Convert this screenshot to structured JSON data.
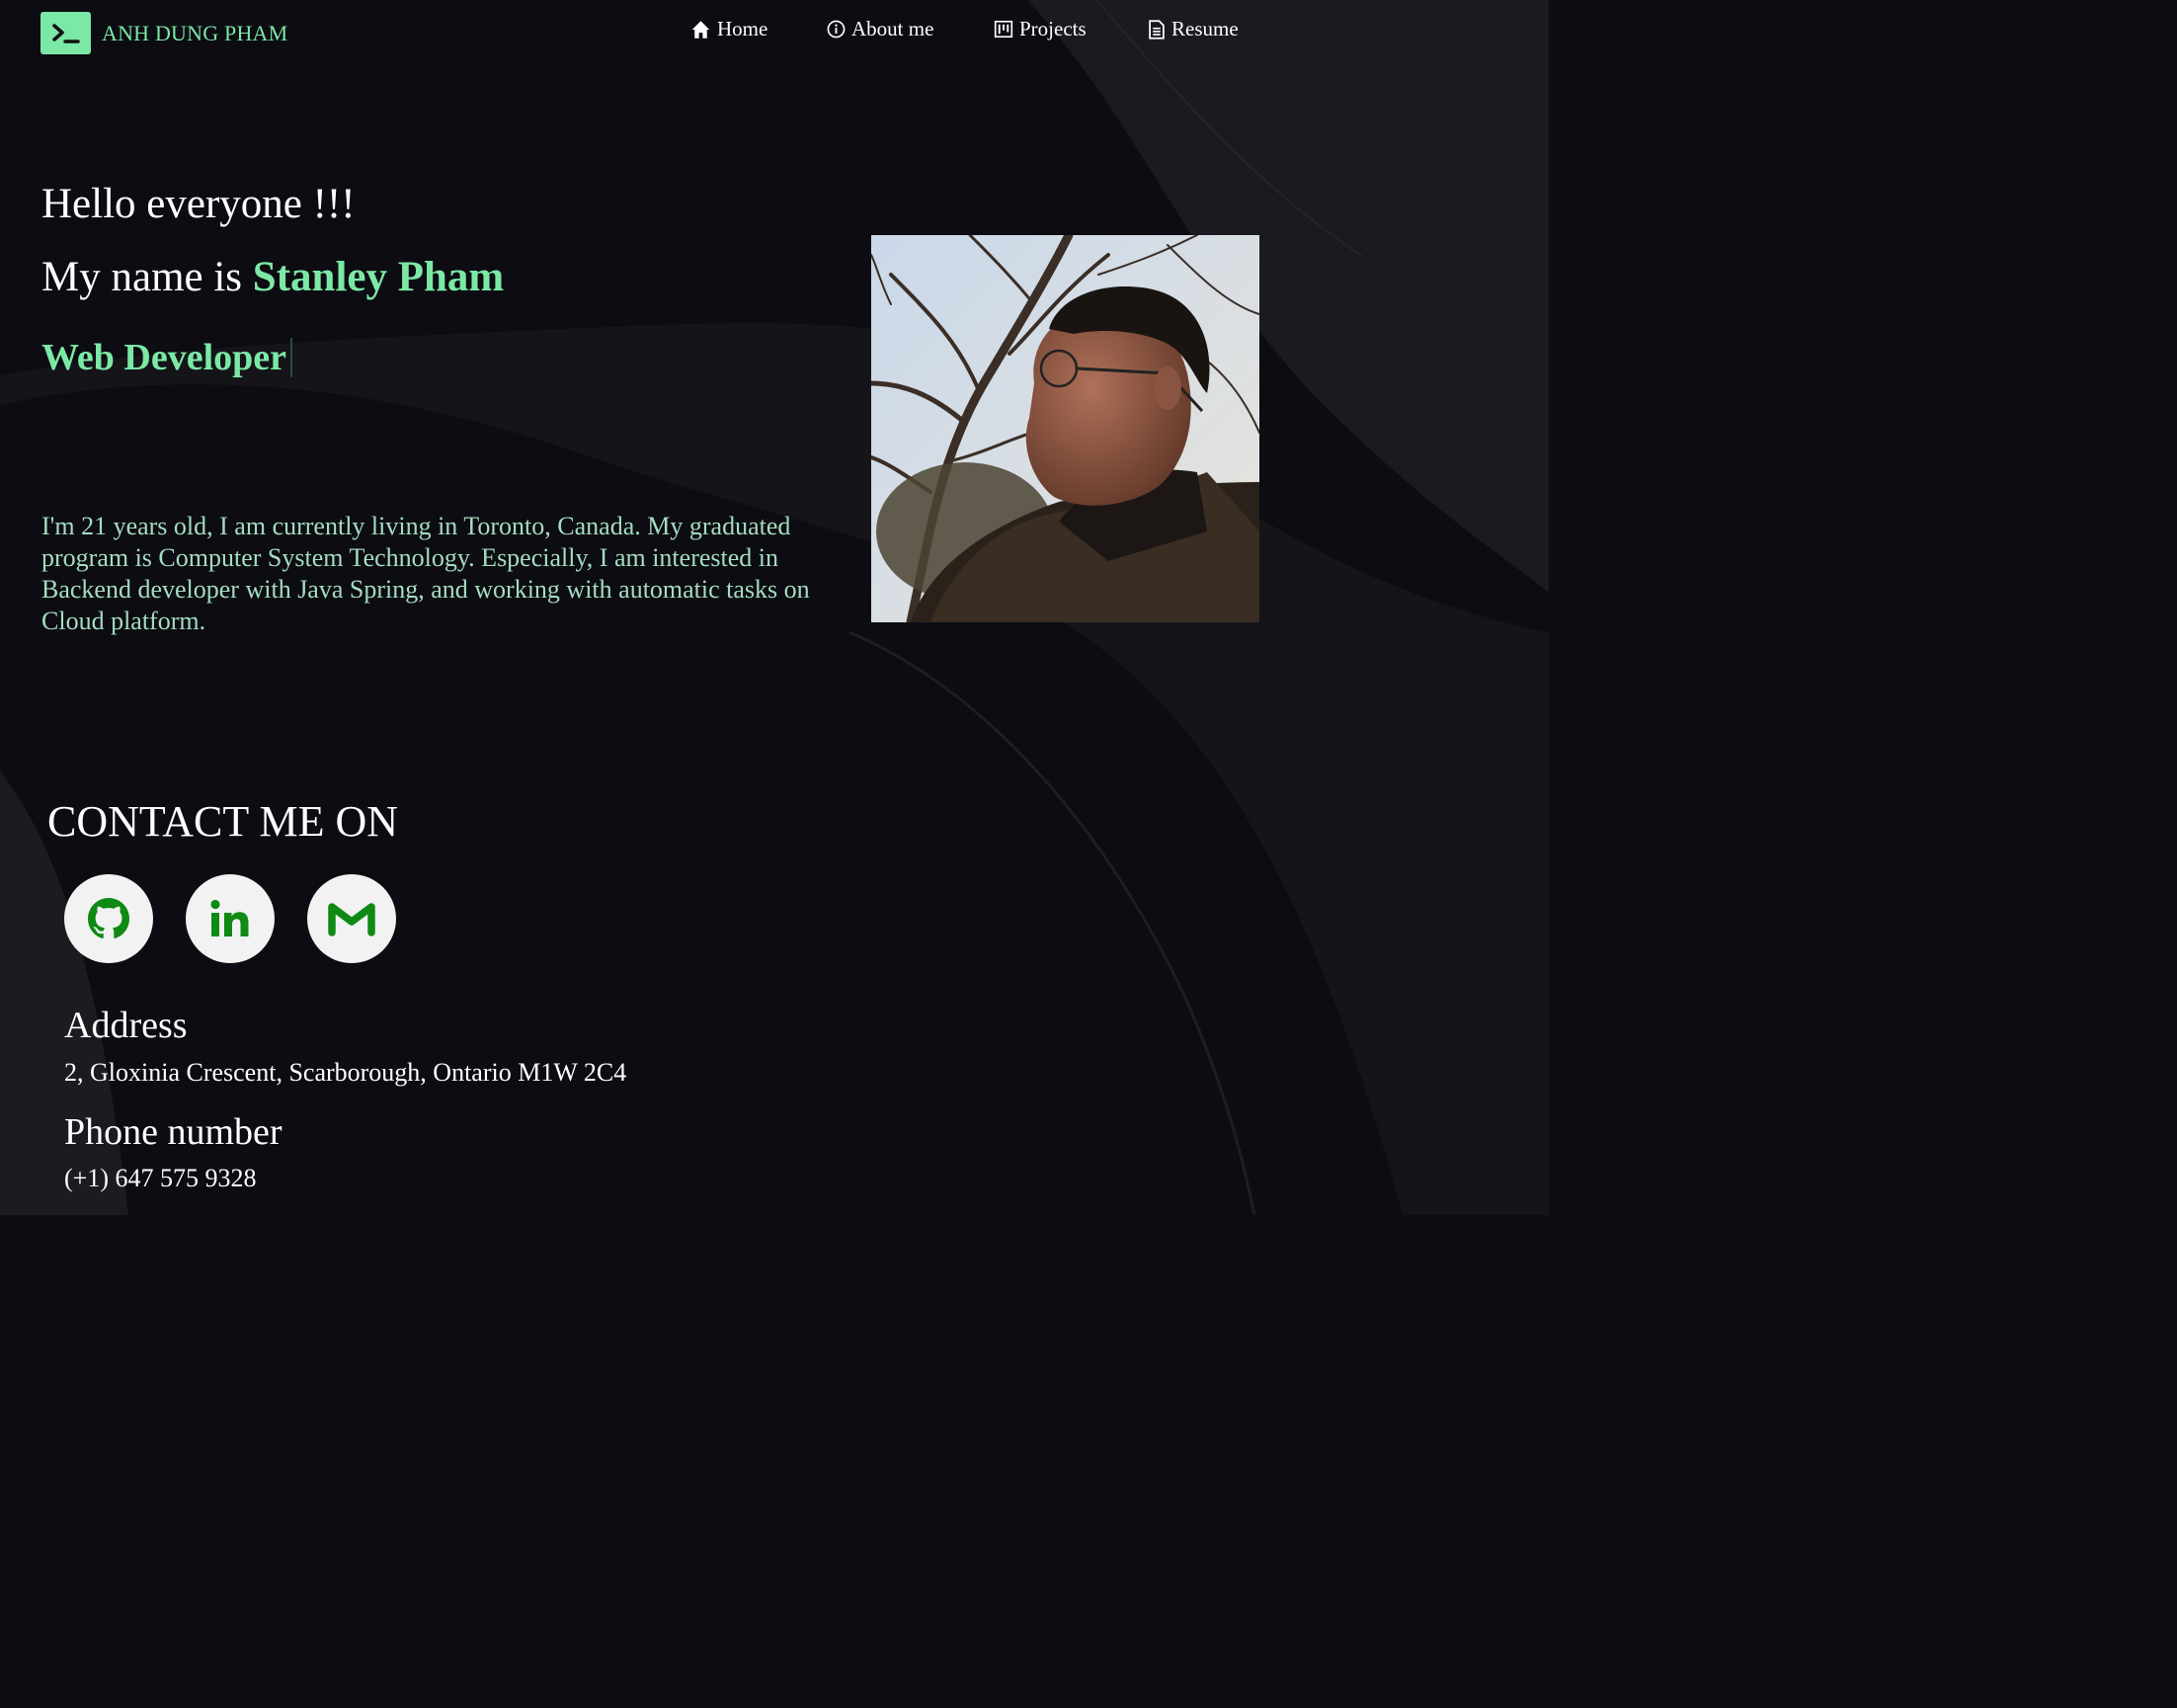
{
  "brand": {
    "name": "ANH DUNG PHAM",
    "icon": "terminal-icon"
  },
  "nav": [
    {
      "label": "Home",
      "icon": "home-icon"
    },
    {
      "label": "About me",
      "icon": "info-icon"
    },
    {
      "label": "Projects",
      "icon": "kanban-icon"
    },
    {
      "label": "Resume",
      "icon": "document-icon"
    }
  ],
  "hero": {
    "greeting": "Hello everyone !!!",
    "name_prefix": "My name is",
    "name": "Stanley Pham",
    "role": "Web Developer",
    "bio": "I'm 21 years old, I am currently living in Toronto, Canada. My graduated program is Computer System Technology. Especially, I am interested in Backend developer with Java Spring, and working with automatic tasks on Cloud platform."
  },
  "contact": {
    "title": "CONTACT ME ON",
    "socials": [
      {
        "icon": "github-icon"
      },
      {
        "icon": "linkedin-icon"
      },
      {
        "icon": "gmail-icon"
      }
    ],
    "address_label": "Address",
    "address": "2, Gloxinia Crescent, Scarborough, Ontario M1W 2C4",
    "phone_label": "Phone number",
    "phone": "(+1) 647 575 9328"
  },
  "colors": {
    "accent": "#7ce8a6",
    "background": "#0c0c12",
    "bio_text": "#a5dcc0",
    "social_icon": "#0f8a14"
  }
}
